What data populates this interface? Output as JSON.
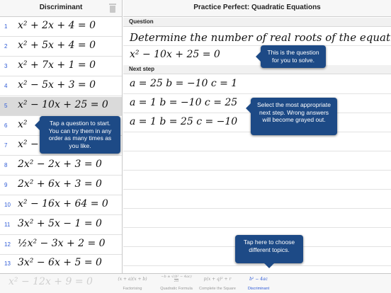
{
  "sidebar": {
    "title": "Discriminant",
    "items": [
      {
        "num": "1",
        "eq": "x² + 2x + 4 = 0"
      },
      {
        "num": "2",
        "eq": "x² + 5x + 4 = 0"
      },
      {
        "num": "3",
        "eq": "x² + 7x + 1 = 0"
      },
      {
        "num": "4",
        "eq": "x² − 5x + 3 = 0"
      },
      {
        "num": "5",
        "eq": "x² − 10x + 25 = 0"
      },
      {
        "num": "6",
        "eq": "x²"
      },
      {
        "num": "7",
        "eq": "x² −"
      },
      {
        "num": "8",
        "eq": "2x² − 2x + 3 = 0"
      },
      {
        "num": "9",
        "eq": "2x² + 6x + 3 = 0"
      },
      {
        "num": "10",
        "eq": "x² − 16x + 64 = 0"
      },
      {
        "num": "11",
        "eq": "3x² + 5x − 1 = 0"
      },
      {
        "num": "12",
        "eq": "½x² − 3x + 2 = 0"
      },
      {
        "num": "13",
        "eq": "3x² − 6x + 5 = 0"
      }
    ],
    "selected_index": 4
  },
  "main": {
    "title": "Practice Perfect: Quadratic Equations",
    "question_label": "Question",
    "question_text": "Determine the number of real roots of the equation",
    "question_eq": "x² − 10x + 25 = 0",
    "next_step_label": "Next step",
    "steps": [
      "a = 25 b = −10 c = 1",
      "a = 1 b = −10 c = 25",
      "a = 1 b = 25 c = −10"
    ]
  },
  "callouts": {
    "question": "This is the question for you to solve.",
    "next_step": "Select the most appropriate next step. Wrong answers will become grayed out.",
    "start": "Tap a question to start. You can try them in any order as many times as you like.",
    "topics": "Tap here to choose different topics."
  },
  "tabbar": {
    "ghost_text": "x² − 12x + 9 = 0",
    "tabs": [
      {
        "label": "Factorising",
        "glyph": "(x + a)(x + b)"
      },
      {
        "label": "Quadratic Formula",
        "glyph_num": "−b ± √(b² − 4ac)",
        "glyph_den": "2a"
      },
      {
        "label": "Complete the Square",
        "glyph": "p(x + q)² + r"
      },
      {
        "label": "Discriminant",
        "glyph": "b² − 4ac"
      }
    ],
    "active": "Discriminant"
  },
  "colors": {
    "accent": "#2f5bd6",
    "callout_bg": "#1d4a86",
    "selected_row": "#dadada"
  }
}
